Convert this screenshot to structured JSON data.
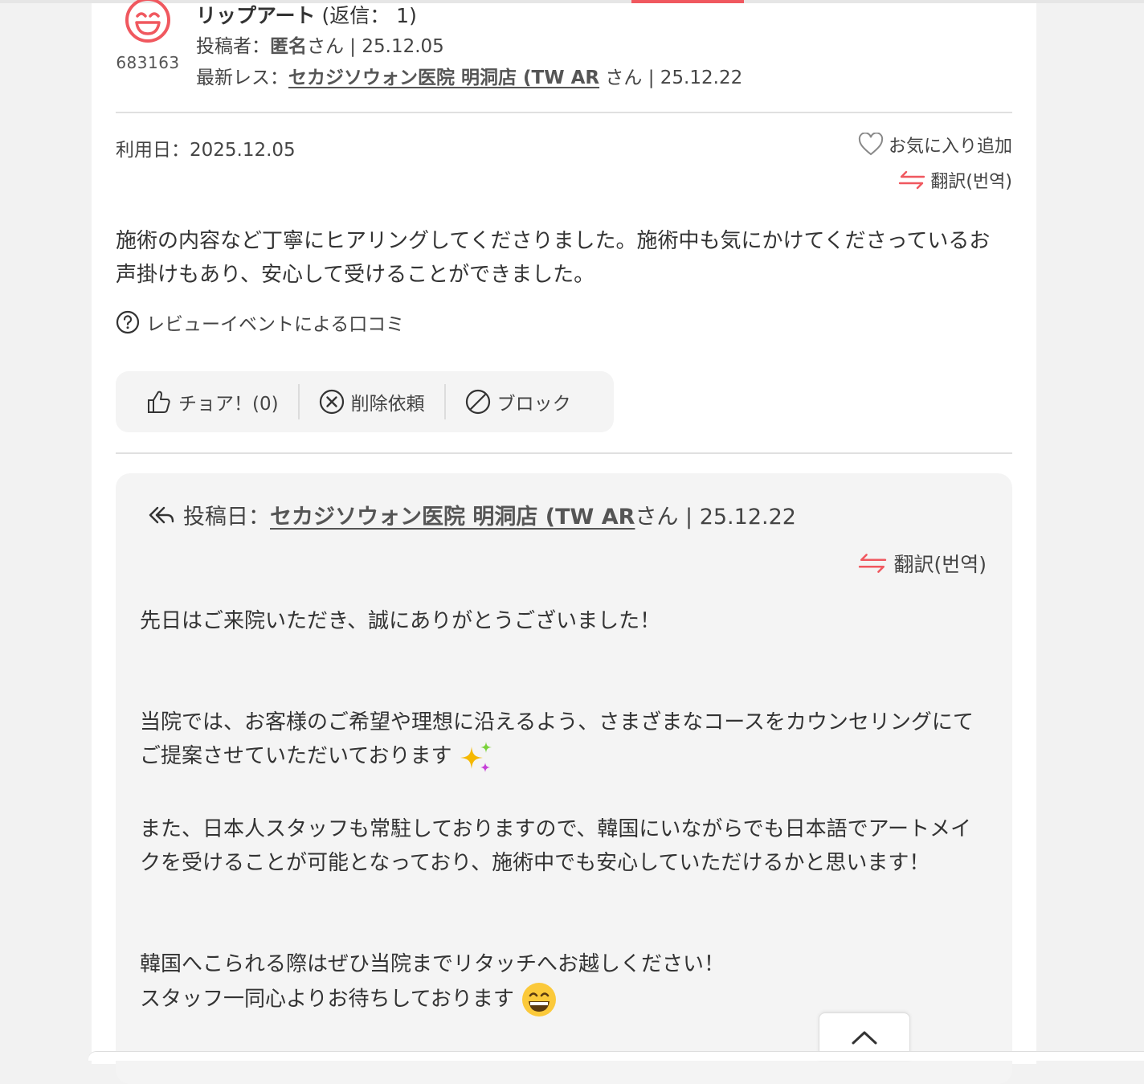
{
  "header": {
    "user_id": "683163",
    "title": "リップアート",
    "reply_count": "(返信： 1)",
    "author_prefix": "投稿者：",
    "author_name": "匿名",
    "author_suffix": "さん | 25.12.05",
    "latest_prefix": "最新レス：",
    "latest_name": "セカジソウォン医院 明洞店 (TW AR",
    "latest_suffix": " さん | 25.12.22"
  },
  "review": {
    "use_date": "利用日：2025.12.05",
    "favorite_label": "お気に入り追加",
    "translate_label": "翻訳(번역)",
    "text": "施術の内容など丁寧にヒアリングしてくださりました。施術中も気にかけてくださっているお声掛けもあり、安心して受けることができました。",
    "event_note": "レビューイベントによる口コミ"
  },
  "actions": {
    "cheer": "チョア！(0)",
    "delete": "削除依頼",
    "block": "ブロック"
  },
  "reply": {
    "date_prefix": "投稿日：",
    "name": "セカジソウォン医院 明洞店 (TW AR",
    "suffix": "さん | 25.12.22",
    "translate_label": "翻訳(번역)",
    "p1": "先日はご来院いただき、誠にありがとうございました！",
    "p2": "当院では、お客様のご希望や理想に沿えるよう、さまざまなコースをカウンセリングにてご提案させていただいております",
    "p3": "また、日本人スタッフも常駐しておりますので、韓国にいながらでも日本語でアートメイクを受けることが可能となっており、施術中でも安心していただけるかと思います！",
    "p4": "韓国へこられる際はぜひ当院までリタッチへお越しください！",
    "p5": "スタッフ一同心よりお待ちしております"
  },
  "colors": {
    "accent": "#f0585f",
    "avatar": "#f0585f"
  },
  "icons": {
    "avatar": "smile-face-icon",
    "favorite": "heart-outline-icon",
    "translate": "swap-arrows-icon",
    "question": "question-circle-icon",
    "cheer": "thumbs-up-icon",
    "delete": "x-circle-icon",
    "block": "prohibited-icon",
    "reply": "reply-all-icon",
    "scroll_top": "chevron-up-icon"
  }
}
